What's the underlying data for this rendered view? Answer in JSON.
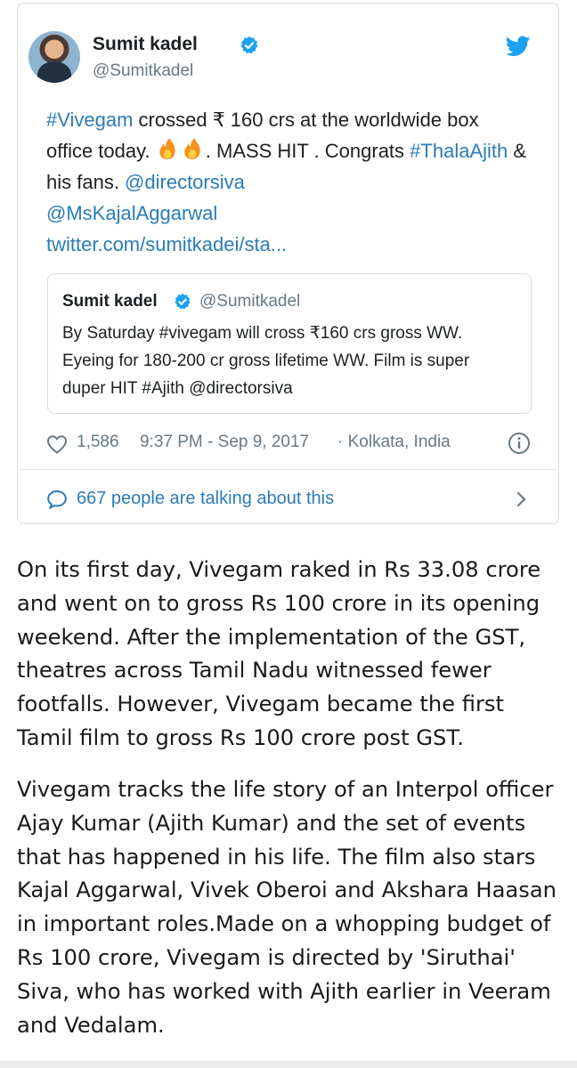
{
  "tweet": {
    "author_name": "Sumit kadel",
    "author_handle": "@Sumitkadel",
    "text": {
      "hashtag_vivegam": "#Vivegam",
      "seg1": " crossed ₹ 160 crs at the worldwide box office today. ",
      "seg2": ". MASS HIT . Congrats ",
      "hashtag_thala": "#ThalaAjith",
      "seg3": " & his fans. ",
      "mention_director": "@directorsiva",
      "mention_kajal": "@MsKajalAggarwal",
      "link": "twitter.com/sumitkadei/sta..."
    },
    "quoted": {
      "author_name": "Sumit kadel",
      "author_handle": "@Sumitkadel",
      "text": "By Saturday #vivegam will cross ₹160 crs gross WW. Eyeing for 180-200 cr gross lifetime WW.  Film is super duper HIT #Ajith @directorsiva"
    },
    "likes": "1,586",
    "timestamp": "9:37 PM - Sep 9, 2017",
    "location": "· Kolkata, India",
    "talking": "667 people are talking about this",
    "icons": [
      "verified-icon",
      "twitter-icon",
      "fire-icon",
      "heart-icon",
      "info-icon",
      "comment-icon",
      "chevron-right-icon"
    ],
    "colors": {
      "link": "#2b7bb9",
      "verified": "#1da1f2",
      "muted": "#697882"
    }
  },
  "article": {
    "paragraph1": "On its first day, Vivegam raked in Rs 33.08 crore and went on to gross Rs 100 crore in its opening weekend. After the implementation of the GST, theatres across Tamil Nadu witnessed fewer footfalls. However, Vivegam became the first Tamil film to gross Rs 100 crore post GST.",
    "paragraph2": "Vivegam tracks the life story of an Interpol officer Ajay Kumar (Ajith Kumar) and the set of events that has happened in his life. The film also stars Kajal Aggarwal, Vivek Oberoi and Akshara Haasan in important roles.Made on a whopping budget of Rs 100 crore, Vivegam is directed by 'Siruthai' Siva, who has worked with Ajith earlier in Veeram and Vedalam."
  }
}
